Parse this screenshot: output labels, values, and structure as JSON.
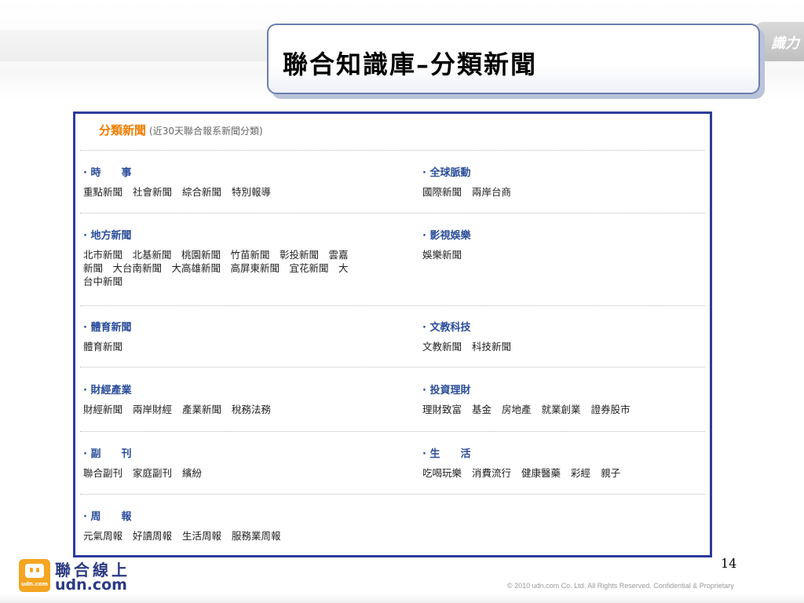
{
  "brand_mark": "識力",
  "title": "聯合知識庫–分類新聞",
  "panel": {
    "heading": "分類新聞",
    "subheading": "(近30天聯合報系新聞分類)",
    "sections": [
      {
        "title": "· 時　　事",
        "links": [
          "重點新聞",
          "社會新聞",
          "綜合新聞",
          "特別報導"
        ]
      },
      {
        "title": "· 全球脈動",
        "links": [
          "國際新聞",
          "兩岸台商"
        ]
      },
      {
        "title": "· 地方新聞",
        "lines": [
          "北市新聞　北基新聞　桃園新聞　竹苗新聞　彰投新聞　雲嘉",
          "新聞　大台南新聞　大高雄新聞　高屏東新聞　宜花新聞　大",
          "台中新聞"
        ]
      },
      {
        "title": "· 影視娛樂",
        "links": [
          "娛樂新聞"
        ]
      },
      {
        "title": "· 體育新聞",
        "links": [
          "體育新聞"
        ]
      },
      {
        "title": "· 文教科技",
        "links": [
          "文教新聞",
          "科技新聞"
        ]
      },
      {
        "title": "· 財經產業",
        "links": [
          "財經新聞",
          "兩岸財經",
          "產業新聞",
          "稅務法務"
        ]
      },
      {
        "title": "· 投資理財",
        "links": [
          "理財致富",
          "基金",
          "房地產",
          "就業創業",
          "證券股市"
        ]
      },
      {
        "title": "· 副　　刊",
        "links": [
          "聯合副刊",
          "家庭副刊",
          "繽紛"
        ]
      },
      {
        "title": "· 生　　活",
        "links": [
          "吃喝玩樂",
          "消費流行",
          "健康醫藥",
          "彩經",
          "親子"
        ]
      },
      {
        "title": "· 周　　報",
        "links": [
          "元氣周報",
          "好讀周報",
          "生活周報",
          "服務業周報"
        ]
      }
    ]
  },
  "footer": {
    "page_number": "14",
    "logo_cn": "聯合線上",
    "logo_en": "udn.com",
    "logo_small": "udn.com",
    "copyright": "© 2010 udn.com Co. Ltd. All Rights Reserved. Confidential & Proprietary"
  },
  "colors": {
    "panel_border": "#2d3b9c",
    "section_title": "#2a4d9a",
    "heading_orange": "#f07d00",
    "logo_orange": "#f4a521"
  }
}
